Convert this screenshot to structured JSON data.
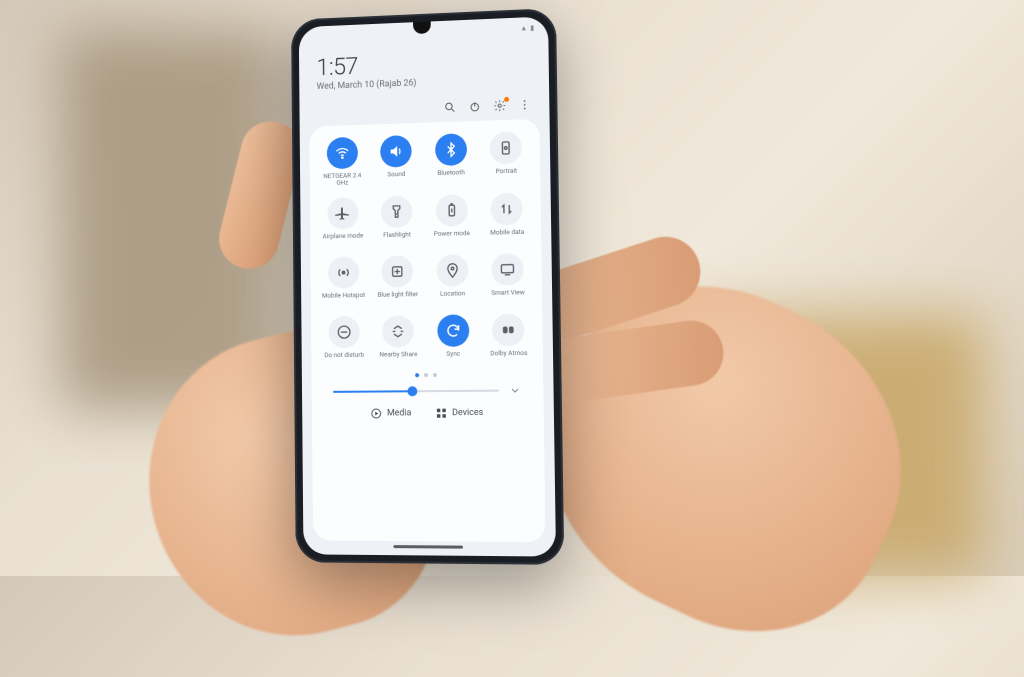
{
  "status": {
    "time_small": "1:57"
  },
  "header": {
    "time": "1:57",
    "date": "Wed, March 10 (Rajab 26)"
  },
  "toolbar": {
    "search": "Search",
    "power": "Power",
    "settings": "Settings",
    "more": "More",
    "settings_has_badge": true
  },
  "tiles": [
    {
      "label": "NETGEAR 2.4 GHz",
      "icon": "wifi",
      "active": true
    },
    {
      "label": "Sound",
      "icon": "sound",
      "active": true
    },
    {
      "label": "Bluetooth",
      "icon": "bluetooth",
      "active": true
    },
    {
      "label": "Portrait",
      "icon": "portrait",
      "active": false
    },
    {
      "label": "Airplane mode",
      "icon": "airplane",
      "active": false
    },
    {
      "label": "Flashlight",
      "icon": "flashlight",
      "active": false
    },
    {
      "label": "Power mode",
      "icon": "powermode",
      "active": false
    },
    {
      "label": "Mobile data",
      "icon": "mobiledata",
      "active": false
    },
    {
      "label": "Mobile Hotspot",
      "icon": "hotspot",
      "active": false
    },
    {
      "label": "Blue light filter",
      "icon": "bluelight",
      "active": false
    },
    {
      "label": "Location",
      "icon": "location",
      "active": false
    },
    {
      "label": "Smart View",
      "icon": "smartview",
      "active": false
    },
    {
      "label": "Do not disturb",
      "icon": "dnd",
      "active": false
    },
    {
      "label": "Nearby Share",
      "icon": "nearby",
      "active": false
    },
    {
      "label": "Sync",
      "icon": "sync",
      "active": true
    },
    {
      "label": "Dolby Atmos",
      "icon": "dolby",
      "active": false
    }
  ],
  "pager": {
    "total": 3,
    "active_index": 0
  },
  "brightness": {
    "percent": 48
  },
  "bottom": {
    "media_label": "Media",
    "devices_label": "Devices"
  },
  "colors": {
    "accent": "#2b7ff0",
    "panel_bg": "#fcfdfe",
    "screen_bg": "#eef1f5"
  }
}
